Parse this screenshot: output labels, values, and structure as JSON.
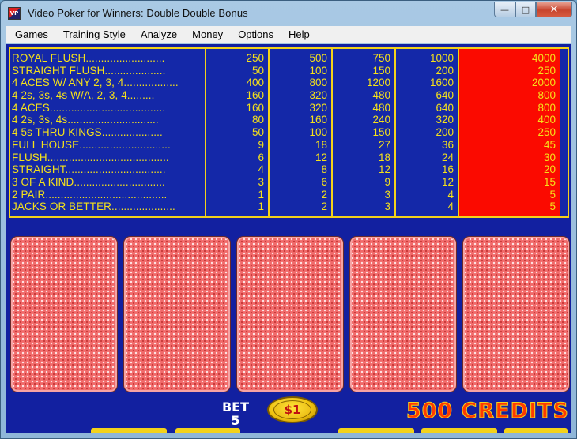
{
  "window": {
    "title": "Video Poker for Winners: Double Double Bonus",
    "icon_text": "VP",
    "buttons": {
      "minimize": "—",
      "maximize": "□",
      "close": "✕"
    }
  },
  "menu": [
    "Games",
    "Training Style",
    "Analyze",
    "Money",
    "Options",
    "Help"
  ],
  "paytable": {
    "hands": [
      "ROYAL FLUSH..........................",
      "STRAIGHT FLUSH....................",
      "4 ACES W/ ANY 2, 3, 4..................",
      "4 2s, 3s, 4s W/A, 2, 3, 4.........",
      "4 ACES......................................",
      "4 2s, 3s, 4s..............................",
      "4 5s THRU KINGS....................",
      "FULL HOUSE..............................",
      "FLUSH........................................",
      "STRAIGHT.................................",
      "3 OF A KIND..............................",
      "2 PAIR........................................",
      "JACKS OR BETTER....................."
    ],
    "columns": [
      [
        "250",
        "50",
        "400",
        "160",
        "160",
        "80",
        "50",
        "9",
        "6",
        "4",
        "3",
        "1",
        "1"
      ],
      [
        "500",
        "100",
        "800",
        "320",
        "320",
        "160",
        "100",
        "18",
        "12",
        "8",
        "6",
        "2",
        "2"
      ],
      [
        "750",
        "150",
        "1200",
        "480",
        "480",
        "240",
        "150",
        "27",
        "18",
        "12",
        "9",
        "3",
        "3"
      ],
      [
        "1000",
        "200",
        "1600",
        "640",
        "640",
        "320",
        "200",
        "36",
        "24",
        "16",
        "12",
        "4",
        "4"
      ],
      [
        "4000",
        "250",
        "2000",
        "800",
        "800",
        "400",
        "250",
        "45",
        "30",
        "20",
        "15",
        "5",
        "5"
      ]
    ],
    "selected_column": 5,
    "colors": {
      "background": "#1428a8",
      "border": "#f3d21a",
      "text": "#f5e11a",
      "selected": "#fb0a00"
    }
  },
  "cards": {
    "count": 5,
    "state": "face-down"
  },
  "hud": {
    "bet_label": "BET",
    "bet_value": "5",
    "coin_label": "$1",
    "credits": "500 CREDITS"
  }
}
